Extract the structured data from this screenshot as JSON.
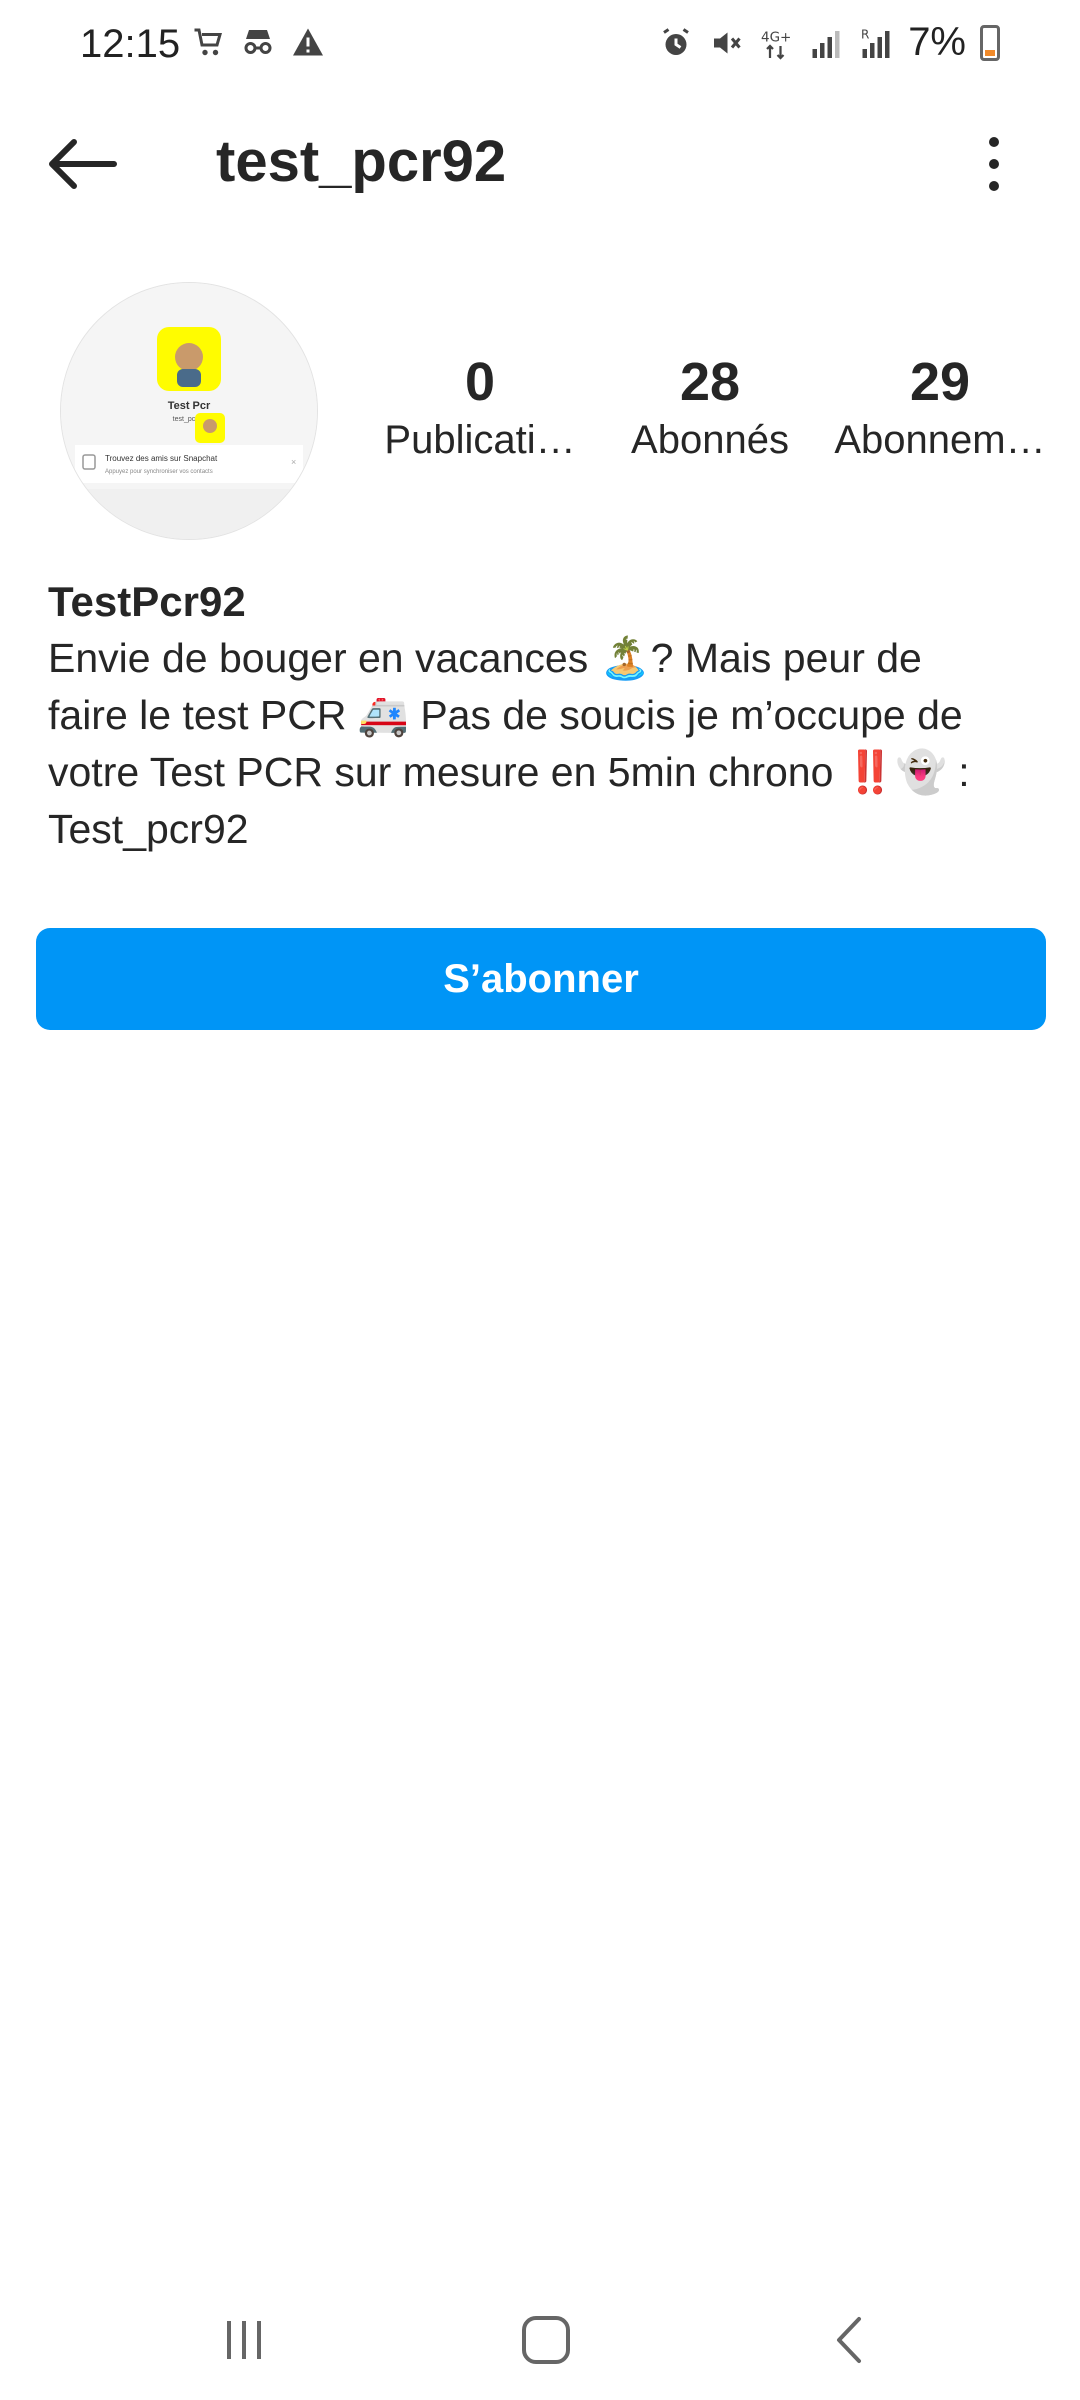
{
  "status_bar": {
    "time": "12:15",
    "battery_text": "7%",
    "left_icons": [
      "cart-icon",
      "incognito-icon",
      "warning-icon"
    ],
    "right_icons": [
      "alarm-icon",
      "mute-icon",
      "network-4g-icon",
      "signal-icon",
      "signal-roaming-icon",
      "battery-icon"
    ]
  },
  "header": {
    "username": "test_pcr92",
    "back_icon": "back-arrow-icon",
    "more_icon": "more-vertical-icon"
  },
  "profile": {
    "avatar": {
      "caption_title": "Test Pcr",
      "caption_sub": "test_pcr92",
      "banner_title": "Trouvez des amis sur Snapchat",
      "banner_sub": "Appuyez pour synchroniser vos contacts"
    },
    "stats": [
      {
        "value": "0",
        "label": "Publicati…"
      },
      {
        "value": "28",
        "label": "Abonnés"
      },
      {
        "value": "29",
        "label": "Abonnem…"
      }
    ],
    "display_name": "TestPcr92",
    "bio_lines": [
      "Envie de bouger en vacances 🏝️? Mais peur de",
      "faire le test PCR 🚑 Pas de soucis je m’occupe de",
      "votre Test PCR sur mesure en 5min chrono ‼️👻 :",
      "Test_pcr92"
    ]
  },
  "follow_button": {
    "label": "S’abonner"
  },
  "colors": {
    "accent": "#0095f6",
    "text": "#262626"
  },
  "nav_bar": {
    "icons": [
      "recent-apps-icon",
      "home-icon",
      "back-icon"
    ]
  }
}
